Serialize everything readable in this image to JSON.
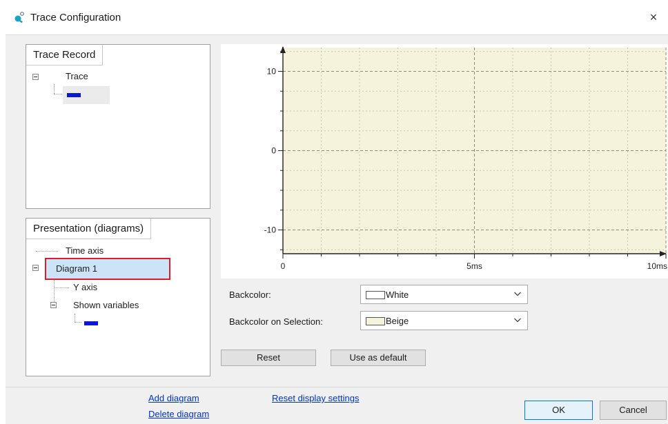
{
  "window": {
    "title": "Trace Configuration",
    "close_glyph": "×"
  },
  "trace_record": {
    "tab_label": "Trace Record",
    "root_label": "Trace",
    "variable_color": "#0b17d8"
  },
  "presentation": {
    "tab_label": "Presentation (diagrams)",
    "items": {
      "time_axis": "Time axis",
      "diagram_1": "Diagram 1",
      "y_axis": "Y axis",
      "shown_variables": "Shown variables"
    },
    "variable_color": "#0b17d8"
  },
  "chart_data": {
    "type": "line",
    "series": [],
    "title": "",
    "xlabel": "",
    "ylabel": "",
    "xlim": [
      0,
      10
    ],
    "ylim": [
      -13,
      13
    ],
    "x_ticks": [
      {
        "value": 0,
        "label": "0"
      },
      {
        "value": 5,
        "label": "5ms"
      },
      {
        "value": 10,
        "label": "10ms"
      }
    ],
    "y_ticks": [
      {
        "value": 10,
        "label": "10"
      },
      {
        "value": 0,
        "label": "0"
      },
      {
        "value": -10,
        "label": "-10"
      }
    ],
    "grid": true,
    "background_color": "#f5f3dc"
  },
  "settings": {
    "backcolor_label": "Backcolor:",
    "backcolor_value": "White",
    "backcolor_swatch": "#ffffff",
    "selection_label": "Backcolor on Selection:",
    "selection_value": "Beige",
    "selection_swatch": "#f5f3dc",
    "dropdown_icon": "chevron-down-icon",
    "reset_button": "Reset",
    "default_button": "Use as default"
  },
  "footer": {
    "add_diagram": "Add diagram",
    "delete_diagram": "Delete diagram",
    "reset_display": "Reset display settings",
    "ok_button": "OK",
    "cancel_button": "Cancel"
  }
}
